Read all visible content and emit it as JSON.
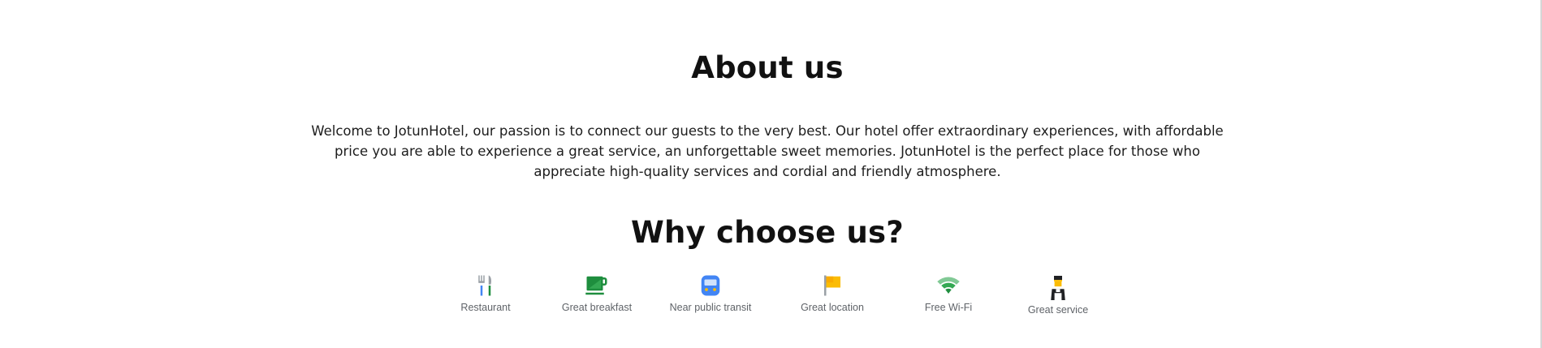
{
  "about": {
    "title": "About us",
    "text": "Welcome to JotunHotel, our passion is to connect our guests to the very best. Our hotel offer extraordinary experiences, with affordable price you are able to experience a great service, an unforgettable sweet memories. JotunHotel is the perfect place for those who appreciate high-quality services and cordial and friendly atmosphere."
  },
  "why": {
    "title": "Why choose us?",
    "features": [
      {
        "label": "Restaurant",
        "icon": "restaurant-icon"
      },
      {
        "label": "Great breakfast",
        "icon": "coffee-cup-icon"
      },
      {
        "label": "Near public transit",
        "icon": "bus-icon"
      },
      {
        "label": "Great location",
        "icon": "flag-icon"
      },
      {
        "label": "Free Wi-Fi",
        "icon": "wifi-icon"
      },
      {
        "label": "Great service",
        "icon": "concierge-icon"
      }
    ]
  },
  "colors": {
    "heading": "#111111",
    "body_text": "#1d1d1d",
    "feature_label": "#5f6368",
    "green": "#1e8e3e",
    "blue": "#4285f4",
    "yellow": "#fbbc04"
  }
}
